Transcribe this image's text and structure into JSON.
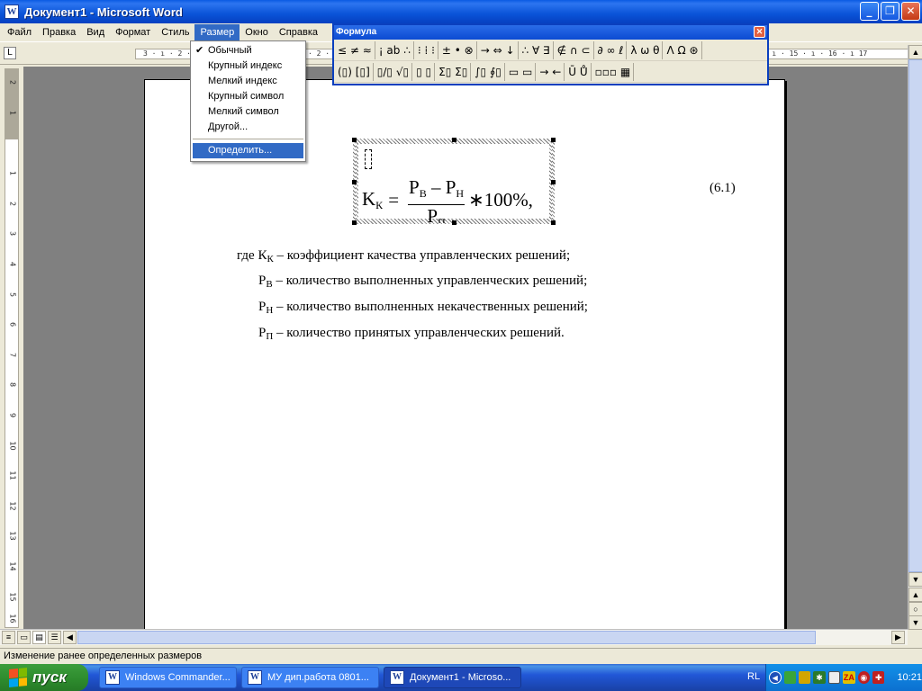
{
  "window": {
    "title": "Документ1 - Microsoft Word",
    "app_icon": "W",
    "buttons": {
      "minimize": "_",
      "maximize": "❐",
      "close": "✕"
    }
  },
  "menubar": {
    "items": [
      "Файл",
      "Правка",
      "Вид",
      "Формат",
      "Стиль",
      "Размер",
      "Окно",
      "Справка"
    ],
    "active_index": 5
  },
  "ruler": {
    "horizontal_text": "3 · ı · 2 · ı · 1 · ı · X · ı · 1 · ı · 2 · ı · 3 · ı · 4 · ı · 5 · ı · 6 · ı · 7 · ı · 8 · ı · 9 · ı · 10 · ı · 11 · ı · 12 · ı · 13 · ı · 14 · ı · 15 · ı · 16 · ı 17",
    "vertical_numbers": [
      "2",
      "1",
      "1",
      "2",
      "3",
      "4",
      "5",
      "6",
      "7",
      "8",
      "9",
      "10",
      "11",
      "12",
      "13",
      "14",
      "15",
      "16"
    ]
  },
  "size_menu": {
    "items": [
      {
        "label": "Обычный",
        "checked": true
      },
      {
        "label": "Крупный индекс",
        "checked": false
      },
      {
        "label": "Мелкий индекс",
        "checked": false
      },
      {
        "label": "Крупный символ",
        "checked": false
      },
      {
        "label": "Мелкий символ",
        "checked": false
      },
      {
        "label": "Другой...",
        "checked": false
      }
    ],
    "define_label": "Определить..."
  },
  "formula_toolbar": {
    "title": "Формула",
    "row1": [
      "≤ ≠ ≈",
      "¡ ab ∴",
      "⁝ ⁞ ⁝",
      "± • ⊗",
      "→ ⇔ ↓",
      "∴ ∀ ∃",
      "∉ ∩ ⊂",
      "∂ ∞ ℓ",
      "λ ω θ",
      "Λ Ω ⊛"
    ],
    "row2": [
      "(▯) [▯]",
      "▯/▯ √▯",
      "▯ ▯",
      "Σ▯ Σ▯",
      "∫▯ ∮▯",
      "▭ ▭",
      "→ ←",
      "Ū Ů",
      "▫▫▫ ▦"
    ]
  },
  "document": {
    "equation": {
      "lhs": "K",
      "lhs_sub": "К",
      "equals": "=",
      "num_a": "P",
      "num_a_sub": "В",
      "minus": " – ",
      "num_b": "P",
      "num_b_sub": "Н",
      "den": "P",
      "den_sub": "П",
      "tail": "∗100%,"
    },
    "eq_number": "(6.1)",
    "definitions": [
      {
        "prefix": "где К",
        "sub": "К",
        "text": " – коэффициент качества управленческих решений;"
      },
      {
        "prefix": "Р",
        "sub": "В",
        "text": " – количество выполненных управленческих решений;"
      },
      {
        "prefix": "Р",
        "sub": "Н",
        "text": " – количество выполненных некачественных решений;"
      },
      {
        "prefix": "Р",
        "sub": "П",
        "text": " – количество принятых управленческих решений."
      }
    ]
  },
  "statusbar": {
    "text": "Изменение ранее определенных размеров"
  },
  "taskbar": {
    "start_label": "пуск",
    "tasks": [
      {
        "label": "Windows Commander...",
        "icon": "W",
        "active": false
      },
      {
        "label": "МУ дип.работа 0801...",
        "icon": "W",
        "active": false
      },
      {
        "label": "Документ1 - Microso...",
        "icon": "W",
        "active": true
      }
    ],
    "lang": "RL",
    "clock": "10:21"
  },
  "colors": {
    "title_bar": "#0a53d8",
    "menu_highlight": "#316ac5",
    "taskbar": "#2157d7",
    "start_green": "#2d8a2d"
  }
}
